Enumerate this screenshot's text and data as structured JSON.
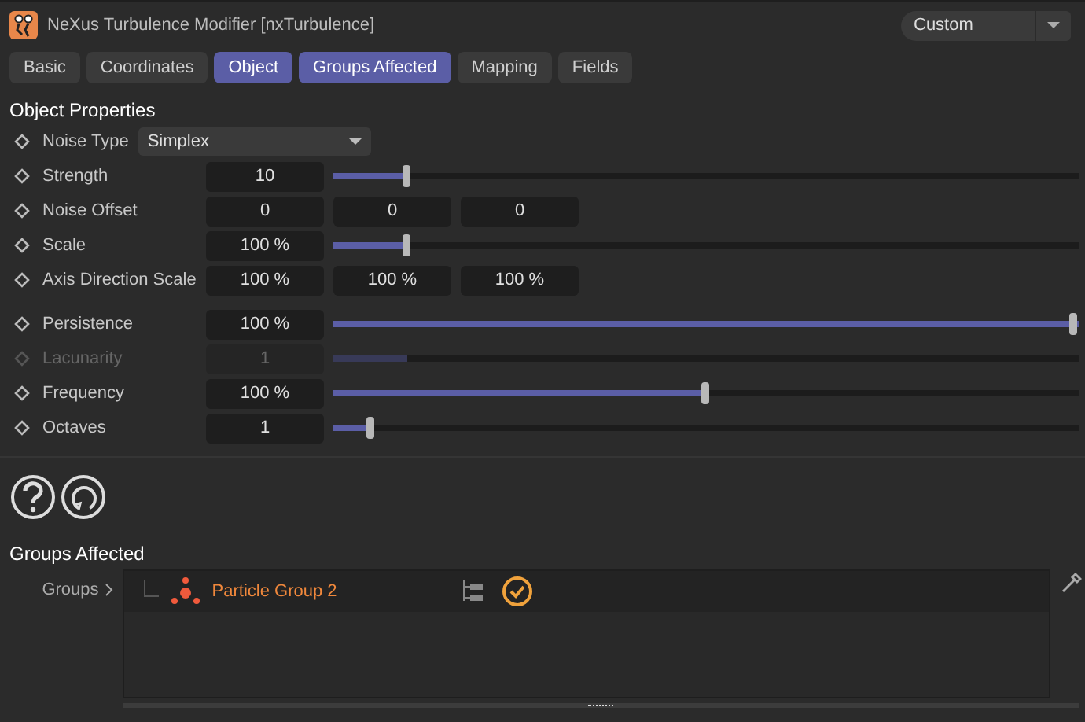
{
  "window": {
    "title": "NeXus Turbulence Modifier [nxTurbulence]",
    "preset": "Custom"
  },
  "tabs": [
    {
      "label": "Basic",
      "selected": false
    },
    {
      "label": "Coordinates",
      "selected": false
    },
    {
      "label": "Object",
      "selected": true
    },
    {
      "label": "Groups Affected",
      "selected": true
    },
    {
      "label": "Mapping",
      "selected": false
    },
    {
      "label": "Fields",
      "selected": false
    }
  ],
  "object_properties": {
    "title": "Object Properties",
    "groups": [
      [
        {
          "kind": "dropdown",
          "label": "Noise Type",
          "value": "Simplex",
          "disabled": false
        },
        {
          "kind": "slider",
          "label": "Strength",
          "value": "10",
          "level": 0.1,
          "disabled": false
        },
        {
          "kind": "vector",
          "label": "Noise Offset",
          "values": [
            "0",
            "0",
            "0"
          ],
          "disabled": false
        },
        {
          "kind": "slider",
          "label": "Scale",
          "value": "100 %",
          "level": 0.1,
          "disabled": false
        },
        {
          "kind": "vector",
          "label": "Axis Direction Scale",
          "values": [
            "100 %",
            "100 %",
            "100 %"
          ],
          "disabled": false
        }
      ],
      [
        {
          "kind": "slider",
          "label": "Persistence",
          "value": "100 %",
          "level": 1,
          "disabled": false
        },
        {
          "kind": "slider",
          "label": "Lacunarity",
          "value": "1",
          "level": 0.1,
          "disabled": true
        },
        {
          "kind": "slider",
          "label": "Frequency",
          "value": "100 %",
          "level": 0.5,
          "disabled": false
        },
        {
          "kind": "slider",
          "label": "Octaves",
          "value": "1",
          "level": 0.05,
          "disabled": false
        }
      ]
    ]
  },
  "groups_affected": {
    "title": "Groups Affected",
    "label": "Groups",
    "items": [
      {
        "name": "Particle Group 2",
        "enabled": true
      }
    ]
  }
}
